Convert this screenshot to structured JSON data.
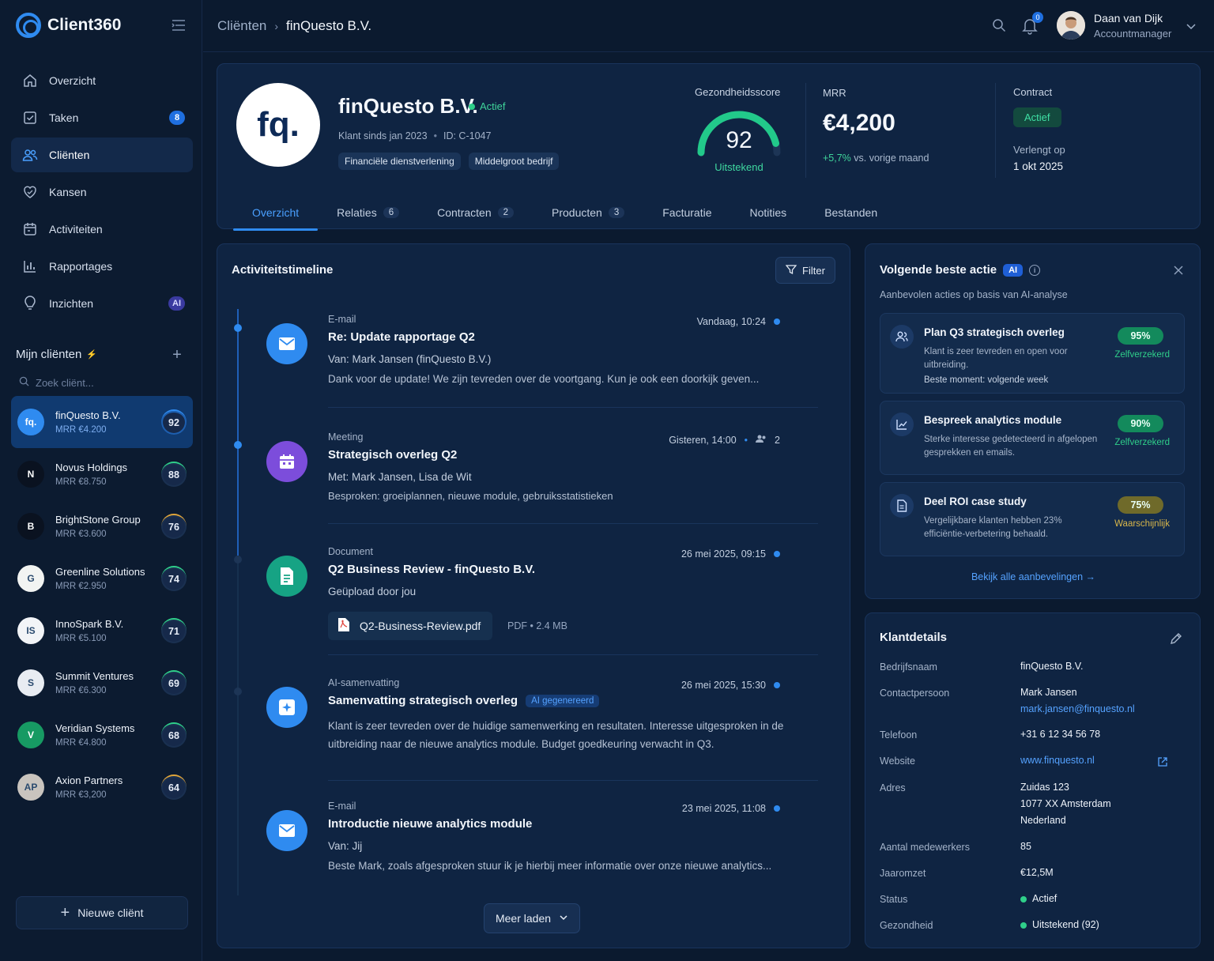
{
  "app": {
    "name": "Client360"
  },
  "nav": [
    {
      "label": "Overzicht",
      "icon": "home-icon"
    },
    {
      "label": "Taken",
      "icon": "checkbox-icon",
      "badge": "8"
    },
    {
      "label": "Cliënten",
      "icon": "users-icon",
      "active": true
    },
    {
      "label": "Kansen",
      "icon": "heart-handshake-icon"
    },
    {
      "label": "Activiteiten",
      "icon": "calendar-icon"
    },
    {
      "label": "Rapportages",
      "icon": "bar-chart-icon"
    },
    {
      "label": "Inzichten",
      "icon": "lightbulb-icon",
      "badge": "AI"
    }
  ],
  "my_clients": {
    "title": "Mijn cliënten",
    "search_placeholder": "Zoek cliënt...",
    "items": [
      {
        "name": "finQuesto B.V.",
        "mrr": "MRR €4.200",
        "score": "92",
        "initials": "fq.",
        "color": "#2f8bf0"
      },
      {
        "name": "Novus Holdings",
        "mrr": "MRR €8.750",
        "score": "88",
        "initials": "N",
        "color": "#0a1220"
      },
      {
        "name": "BrightStone Group",
        "mrr": "MRR €3.600",
        "score": "76",
        "initials": "B",
        "color": "#0a1220"
      },
      {
        "name": "Greenline Solutions",
        "mrr": "MRR €2.950",
        "score": "74",
        "initials": "G",
        "color": "#f2f4f2"
      },
      {
        "name": "InnoSpark B.V.",
        "mrr": "MRR €5.100",
        "score": "71",
        "initials": "IS",
        "color": "#f2f4f7"
      },
      {
        "name": "Summit Ventures",
        "mrr": "MRR €6.300",
        "score": "69",
        "initials": "S",
        "color": "#e8ecf2"
      },
      {
        "name": "Veridian Systems",
        "mrr": "MRR €4.800",
        "score": "68",
        "initials": "V",
        "color": "#179a63"
      },
      {
        "name": "Axion Partners",
        "mrr": "MRR €3,200",
        "score": "64",
        "initials": "AP",
        "color": "#c9c4be"
      }
    ],
    "new_client": "Nieuwe cliënt"
  },
  "topbar": {
    "breadcrumb_parent": "Cliënten",
    "breadcrumb_current": "finQuesto B.V.",
    "notifications": "0",
    "user_name": "Daan van Dijk",
    "user_role": "Accountmanager"
  },
  "client": {
    "logo_text": "fq.",
    "name": "finQuesto B.V.",
    "status": "Actief",
    "since": "Klant sinds jan 2023",
    "id": "ID: C-1047",
    "tags": [
      "Financiële dienstverlening",
      "Middelgroot bedrijf"
    ],
    "health_label": "Gezondheidsscore",
    "health_score": "92",
    "health_fraction": 0.92,
    "health_text": "Uitstekend",
    "mrr_label": "MRR",
    "mrr_value": "€4,200",
    "mrr_change": "+5,7%",
    "mrr_change_text": "vs. vorige maand",
    "contract_label": "Contract",
    "contract_status": "Actief",
    "renew_label": "Verlengt op",
    "renew_date": "1 okt 2025"
  },
  "tabs": [
    {
      "label": "Overzicht",
      "active": true
    },
    {
      "label": "Relaties",
      "count": "6"
    },
    {
      "label": "Contracten",
      "count": "2"
    },
    {
      "label": "Producten",
      "count": "3"
    },
    {
      "label": "Facturatie"
    },
    {
      "label": "Notities"
    },
    {
      "label": "Bestanden"
    }
  ],
  "timeline": {
    "title": "Activiteitstimeline",
    "filter": "Filter",
    "more": "Meer laden",
    "events": [
      {
        "type": "E-mail",
        "title": "Re: Update rapportage Q2",
        "time": "Vandaag, 10:24",
        "line1": "Van: Mark Jansen (finQuesto B.V.)",
        "line2": "Dank voor de update! We zijn tevreden over de voortgang. Kun je ook een doorkijk geven...",
        "icon": "mail-icon",
        "color": "#2f8bf0"
      },
      {
        "type": "Meeting",
        "title": "Strategisch overleg Q2",
        "time": "Gisteren, 14:00",
        "attendees": "2",
        "line1": "Met: Mark Jansen, Lisa de Wit",
        "line2": "Besproken: groeiplannen, nieuwe module, gebruiksstatistieken",
        "icon": "calendar-icon",
        "color": "#7c4ddb"
      },
      {
        "type": "Document",
        "title": "Q2 Business Review - finQuesto B.V.",
        "time": "26 mei 2025, 09:15",
        "line1": "Geüpload door jou",
        "file": "Q2-Business-Review.pdf",
        "file_meta": "PDF  •  2.4 MB",
        "icon": "document-icon",
        "color": "#16a384"
      },
      {
        "type": "AI-samenvatting",
        "title": "Samenvatting strategisch overleg",
        "ai_tag": "AI gegenereerd",
        "time": "26 mei 2025, 15:30",
        "text": "Klant is zeer tevreden over de huidige samenwerking en resultaten. Interesse uitgesproken in de uitbreiding naar de nieuwe analytics module. Budget goedkeuring verwacht in Q3.",
        "icon": "ai-sparkle-icon",
        "color": "#2f8bf0"
      },
      {
        "type": "E-mail",
        "title": "Introductie nieuwe analytics module",
        "time": "23 mei 2025, 11:08",
        "line1": "Van: Jij",
        "line2": "Beste Mark, zoals afgesproken stuur ik je hierbij meer informatie over onze nieuwe analytics...",
        "icon": "mail-icon",
        "color": "#2f8bf0"
      }
    ]
  },
  "next_action": {
    "title": "Volgende beste actie",
    "badge": "AI",
    "subtitle": "Aanbevolen acties op basis van AI-analyse",
    "see_all": "Bekijk alle aanbevelingen",
    "items": [
      {
        "title": "Plan Q3 strategisch overleg",
        "desc": "Klant is zeer tevreden en open voor uitbreiding.",
        "when": "Beste moment: volgende week",
        "pct": "95%",
        "conf": "Zelfverzekerd",
        "pct_color": "#138a5c",
        "conf_color": "#2fcf8a",
        "icon": "users-icon"
      },
      {
        "title": "Bespreek analytics module",
        "desc": "Sterke interesse gedetecteerd in afgelopen gesprekken en emails.",
        "pct": "90%",
        "conf": "Zelfverzekerd",
        "pct_color": "#138a5c",
        "conf_color": "#2fcf8a",
        "icon": "chart-icon"
      },
      {
        "title": "Deel ROI case study",
        "desc": "Vergelijkbare klanten hebben 23% efficiëntie-verbetering behaald.",
        "pct": "75%",
        "conf": "Waarschijnlijk",
        "pct_color": "#6f6a2a",
        "conf_color": "#d8b64a",
        "icon": "document-icon"
      }
    ]
  },
  "details": {
    "title": "Klantdetails",
    "rows": [
      {
        "label": "Bedrijfsnaam",
        "value": "finQuesto B.V."
      },
      {
        "label": "Contactpersoon",
        "value": "Mark Jansen",
        "link": "mark.jansen@finquesto.nl"
      },
      {
        "label": "Telefoon",
        "value": "+31 6 12 34 56 78"
      },
      {
        "label": "Website",
        "link": "www.finquesto.nl"
      },
      {
        "label": "Adres",
        "lines": [
          "Zuidas 123",
          "1077 XX Amsterdam",
          "Nederland"
        ]
      },
      {
        "label": "Aantal medewerkers",
        "value": "85"
      },
      {
        "label": "Jaaromzet",
        "value": "€12,5M"
      },
      {
        "label": "Status",
        "value": "Actief"
      },
      {
        "label": "Gezondheid",
        "value": "Uitstekend (92)"
      }
    ]
  }
}
